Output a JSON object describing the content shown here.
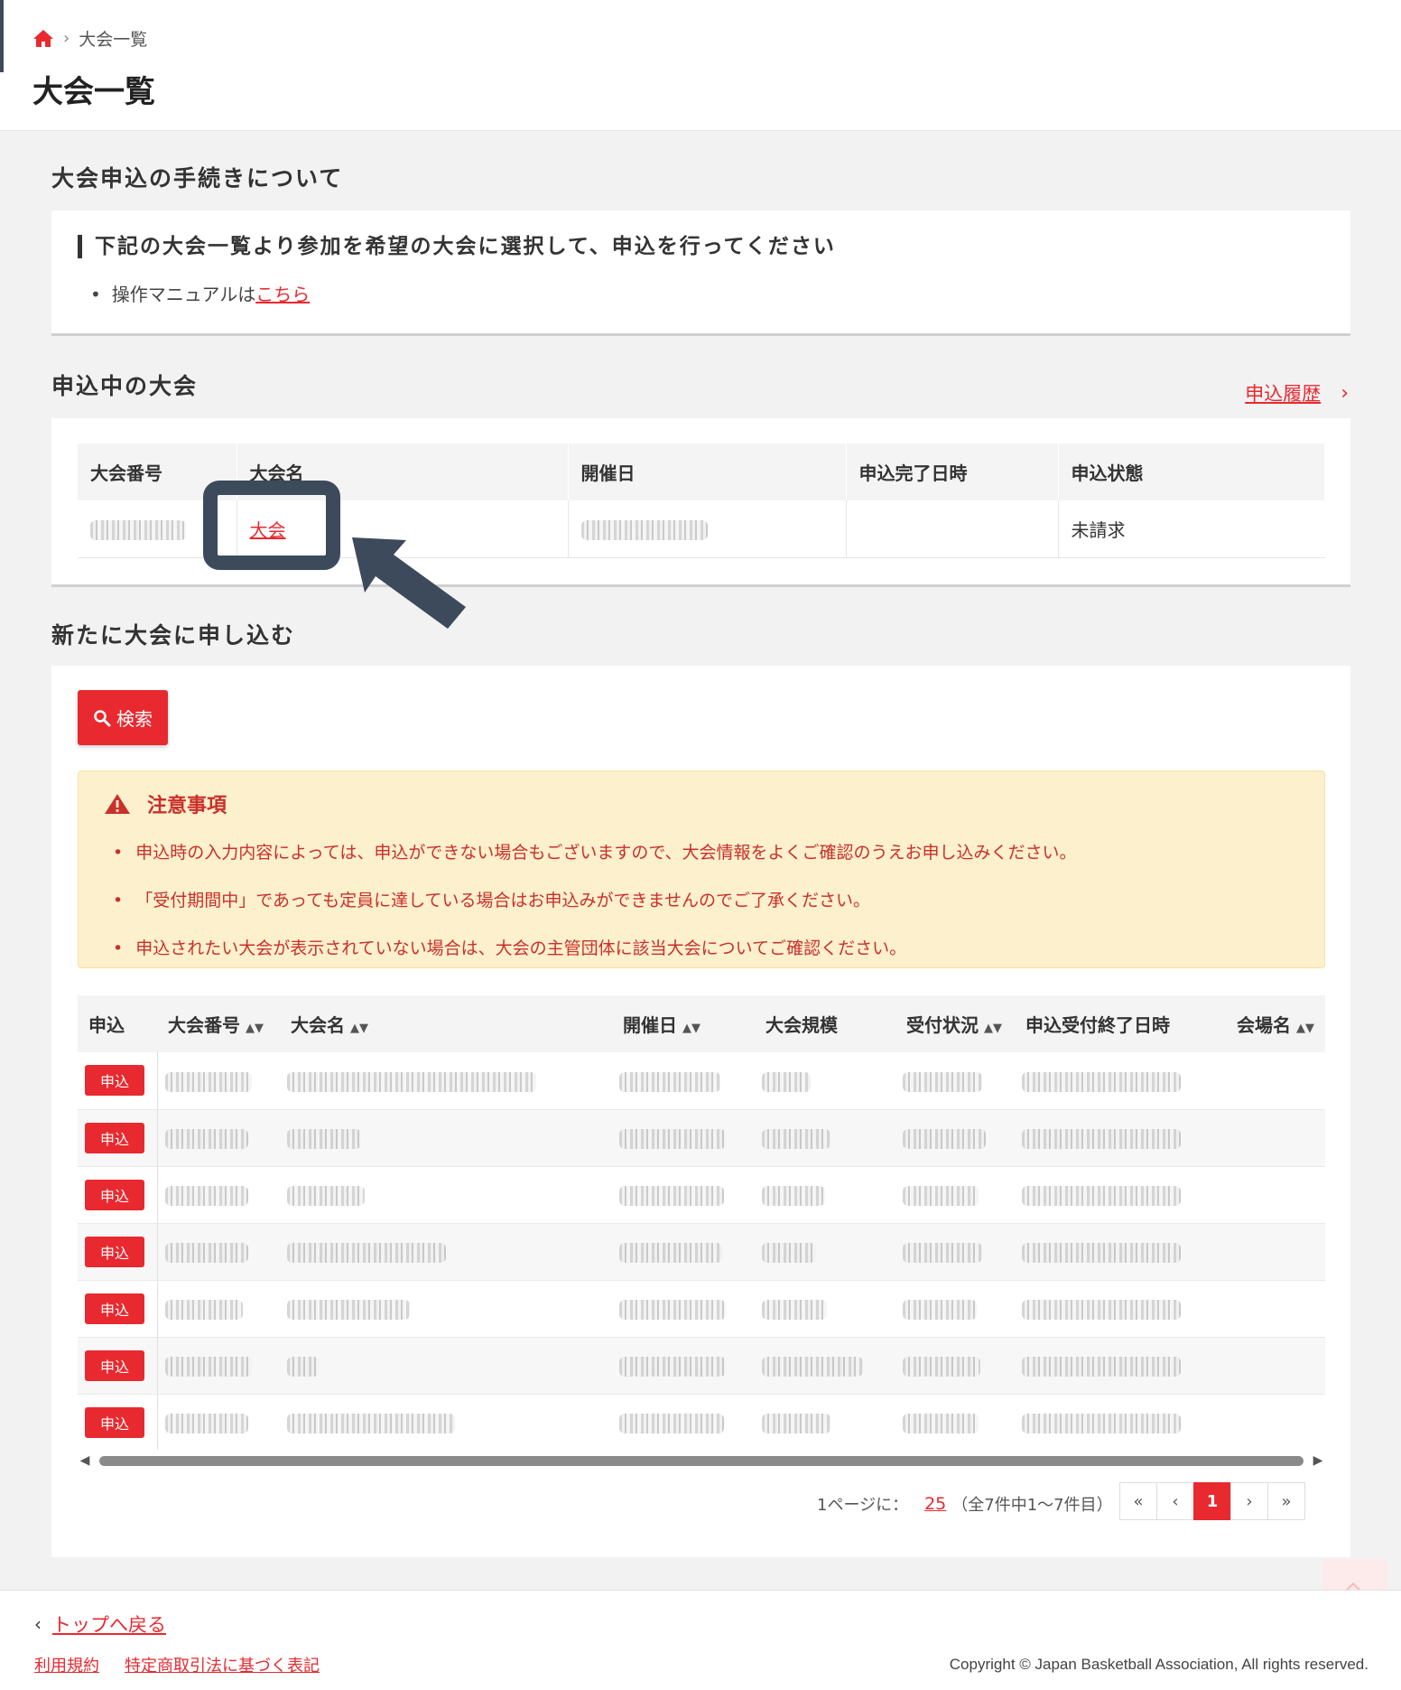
{
  "breadcrumb": {
    "current": "大会一覧"
  },
  "page_title": "大会一覧",
  "procedure": {
    "section_title": "大会申込の手続きについて",
    "heading": "下記の大会一覧より参加を希望の大会に選択して、申込を行ってください",
    "manual_prefix": "操作マニュアルは",
    "manual_link": "こちら"
  },
  "applied": {
    "section_title": "申込中の大会",
    "history_link": "申込履歴",
    "columns": [
      "大会番号",
      "大会名",
      "開催日",
      "申込完了日時",
      "申込状態"
    ],
    "row": {
      "name": "大会",
      "status": "未請求"
    }
  },
  "new_apply": {
    "section_title": "新たに大会に申し込む",
    "search_button": "検索",
    "notice": {
      "title": "注意事項",
      "items": [
        "申込時の入力内容によっては、申込ができない場合もございますので、大会情報をよくご確認のうえお申し込みください。",
        "「受付期間中」であっても定員に達している場合はお申込みができませんのでご了承ください。",
        "申込されたい大会が表示されていない場合は、大会の主管団体に該当大会についてご確認ください。"
      ]
    },
    "columns": [
      "申込",
      "大会番号",
      "大会名",
      "開催日",
      "大会規模",
      "受付状況",
      "申込受付終了日時",
      "会場名"
    ],
    "apply_label": "申込",
    "pagination": {
      "per_page_label": "1ページに：",
      "per_page_value": "25",
      "summary": "（全7件中1～7件目）",
      "first": "«",
      "prev": "‹",
      "current": "1",
      "next": "›",
      "last": "»"
    }
  },
  "footer": {
    "back_link": "トップへ戻る",
    "terms": "利用規約",
    "tokusho": "特定商取引法に基づく表記",
    "copyright": "Copyright © Japan Basketball Association, All rights reserved."
  },
  "colors": {
    "accent": "#e8292f",
    "annotation": "#3c4a5c",
    "notice_bg": "#fdf0cc"
  }
}
